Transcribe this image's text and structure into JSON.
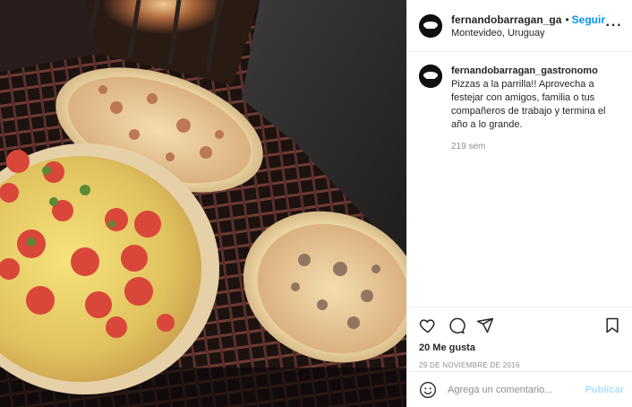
{
  "header": {
    "username": "fernandobarragan_gastronomo",
    "separator": "•",
    "follow_label": "Seguir",
    "location": "Montevideo, Uruguay",
    "more_icon": "more-horizontal-icon"
  },
  "caption": {
    "username": "fernandobarragan_gastronomo",
    "text": "Pizzas a la parrilla!! Aprovecha a festejar con amigos, familia o tus compañeros de trabajo y termina el año a lo grande.",
    "time_ago": "219 sem"
  },
  "actions": {
    "icons": [
      "heart-icon",
      "comment-icon",
      "share-icon",
      "bookmark-icon"
    ],
    "likes": "20 Me gusta",
    "date": "29 DE NOVIEMBRE DE 2016"
  },
  "comment_form": {
    "placeholder": "Agrega un comentario...",
    "publish_label": "Publicar"
  },
  "photo": {
    "subject": "pizzas-on-grill"
  },
  "colors": {
    "link_blue": "#0095f6",
    "publish_disabled": "#b2dffc",
    "secondary_text": "#8e8e8e"
  }
}
